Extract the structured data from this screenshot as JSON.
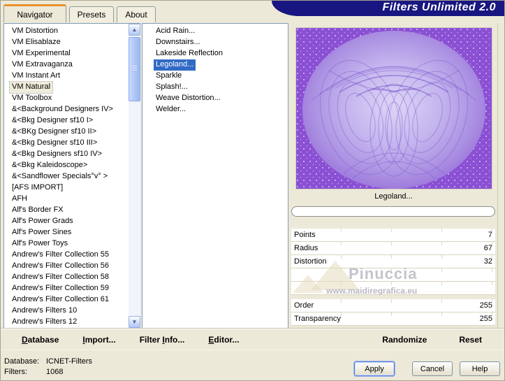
{
  "title": "Filters Unlimited 2.0",
  "tabs": [
    {
      "label": "Navigator"
    },
    {
      "label": "Presets"
    },
    {
      "label": "About"
    }
  ],
  "left_list": {
    "selected_index": 5,
    "items": [
      "VM Distortion",
      "VM Elisablaze",
      "VM Experimental",
      "VM Extravaganza",
      "VM Instant Art",
      "VM Natural",
      "VM Toolbox",
      "&<Background Designers IV>",
      "&<Bkg Designer sf10 I>",
      "&<BKg Designer sf10 II>",
      "&<Bkg Designer sf10 III>",
      "&<Bkg Designers sf10 IV>",
      "&<Bkg Kaleidoscope>",
      "&<Sandflower Specials°v° >",
      "[AFS IMPORT]",
      "AFH",
      "Alf's Border FX",
      "Alf's Power Grads",
      "Alf's Power Sines",
      "Alf's Power Toys",
      "Andrew's Filter Collection 55",
      "Andrew's Filter Collection 56",
      "Andrew's Filter Collection 58",
      "Andrew's Filter Collection 59",
      "Andrew's Filter Collection 61",
      "Andrew's Filters 10",
      "Andrew's Filters 12"
    ]
  },
  "filter_list": {
    "selected_index": 3,
    "items": [
      "Acid Rain...",
      "Downstairs...",
      "Lakeside Reflection",
      "Legoland...",
      "Sparkle",
      "Splash!...",
      "Weave Distortion...",
      "Welder..."
    ]
  },
  "preview": {
    "caption": "Legoland...",
    "progress_value": ""
  },
  "sliders": [
    {
      "label": "Points",
      "value": "7"
    },
    {
      "label": "Radius",
      "value": "67"
    },
    {
      "label": "Distortion",
      "value": "32"
    },
    {
      "label": "",
      "value": ""
    },
    {
      "label": "",
      "value": ""
    },
    {
      "label": "Order",
      "value": "255"
    },
    {
      "label": "Transparency",
      "value": "255"
    }
  ],
  "watermark": {
    "name": "Pinuccia",
    "url": "www.maidiregrafica.eu"
  },
  "toolbar": {
    "database": {
      "pre": "",
      "u": "D",
      "post": "atabase"
    },
    "import": {
      "pre": "",
      "u": "I",
      "post": "mport..."
    },
    "filter_info": {
      "pre": "Filter ",
      "u": "I",
      "post": "nfo..."
    },
    "editor": {
      "pre": "",
      "u": "E",
      "post": "ditor..."
    },
    "randomize": "Randomize",
    "reset": "Reset"
  },
  "status": {
    "database_label": "Database:",
    "database_value": "ICNET-Filters",
    "filters_label": "Filters:",
    "filters_value": "1068"
  },
  "actions": {
    "apply": "Apply",
    "cancel": "Cancel",
    "help": "Help"
  },
  "icons": {
    "scroll_up": "▲",
    "scroll_down": "▼"
  },
  "colors": {
    "title_bar": "#181680",
    "selection_blue": "#316ac5",
    "tab_accent": "#e8912d",
    "dialog_bg": "#ece9d8",
    "preview_background_purple": "#8a50d4",
    "preview_orb_lavender": "#c4b6ee"
  }
}
